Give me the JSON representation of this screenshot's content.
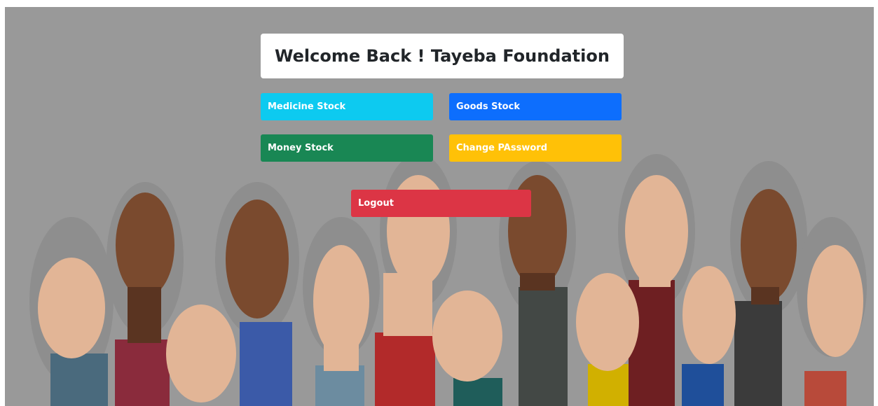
{
  "header": {
    "welcome_text": "Welcome Back ! Tayeba Foundation"
  },
  "menu": {
    "medicine_stock_label": "Medicine Stock",
    "goods_stock_label": "Goods Stock",
    "money_stock_label": "Money Stock",
    "change_password_label": "Change PAssword",
    "logout_label": "Logout"
  },
  "colors": {
    "info": "#0dcaf0",
    "primary": "#0d6efd",
    "success": "#198754",
    "warning": "#ffc107",
    "danger": "#dc3545",
    "overlay": "#999999"
  },
  "background": {
    "image_subject": "raised-hands-image"
  }
}
